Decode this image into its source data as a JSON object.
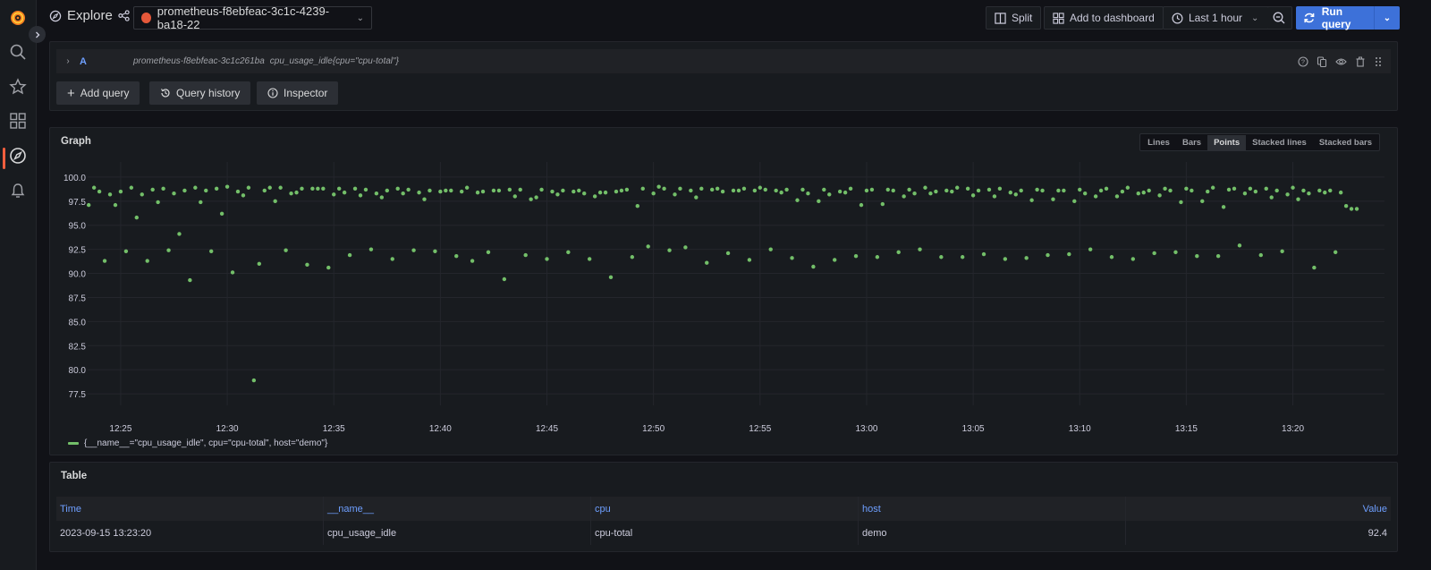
{
  "sidebar": {
    "items": [
      {
        "name": "grafana-logo",
        "label": "Home"
      },
      {
        "name": "search",
        "label": "Search"
      },
      {
        "name": "starred",
        "label": "Starred"
      },
      {
        "name": "dashboards",
        "label": "Dashboards"
      },
      {
        "name": "explore",
        "label": "Explore",
        "active": true
      },
      {
        "name": "alerting",
        "label": "Alerting"
      }
    ]
  },
  "header": {
    "title": "Explore",
    "datasource": "prometheus-f8ebfeac-3c1c-4239-ba18-22",
    "split_label": "Split",
    "add_to_dashboard_label": "Add to dashboard",
    "time_range_label": "Last 1 hour",
    "run_query_label": "Run query"
  },
  "query": {
    "ref_id": "A",
    "datasource": "prometheus-f8ebfeac-3c1c261ba",
    "expression": "cpu_usage_idle{cpu=\"cpu-total\"}",
    "add_query_label": "Add query",
    "query_history_label": "Query history",
    "inspector_label": "Inspector"
  },
  "graph_panel": {
    "title": "Graph",
    "view_options": [
      "Lines",
      "Bars",
      "Points",
      "Stacked lines",
      "Stacked bars"
    ],
    "selected_view": "Points"
  },
  "chart_data": {
    "type": "scatter",
    "title": "Graph",
    "xlabel": "",
    "ylabel": "",
    "x_ticks": [
      "12:25",
      "12:30",
      "12:35",
      "12:40",
      "12:45",
      "12:50",
      "12:55",
      "13:00",
      "13:05",
      "13:10",
      "13:15",
      "13:20"
    ],
    "y_ticks": [
      "77.5",
      "80.0",
      "82.5",
      "85.0",
      "87.5",
      "90.0",
      "92.5",
      "95.0",
      "97.5",
      "100.0"
    ],
    "ylim": [
      76.3,
      101.2
    ],
    "xlim_minutes_from_1225": [
      -1.55,
      59.3
    ],
    "x_interval_seconds": 15,
    "x_start": "12:23:30",
    "grid": true,
    "color": "#73bf69",
    "series": [
      {
        "name": "{__name__=\"cpu_usage_idle\", cpu=\"cpu-total\", host=\"demo\"}",
        "values": [
          97.1,
          98.9,
          98.5,
          91.3,
          98.2,
          97.1,
          98.5,
          92.3,
          98.9,
          95.8,
          98.2,
          91.3,
          98.7,
          97.4,
          98.8,
          92.4,
          98.3,
          94.1,
          98.6,
          89.3,
          98.9,
          97.4,
          98.6,
          92.3,
          98.8,
          96.2,
          99.0,
          90.1,
          98.5,
          98.1,
          98.9,
          78.9,
          91.0,
          98.6,
          98.9,
          97.5,
          98.9,
          92.4,
          98.3,
          98.4,
          98.8,
          90.9,
          98.8,
          98.8,
          98.8,
          90.6,
          98.2,
          98.8,
          98.4,
          91.9,
          98.8,
          98.1,
          98.7,
          92.5,
          98.3,
          97.9,
          98.6,
          91.5,
          98.8,
          98.3,
          98.7,
          92.4,
          98.4,
          97.7,
          98.6,
          92.3,
          98.5,
          98.6,
          98.6,
          91.8,
          98.5,
          98.9,
          91.3,
          98.4,
          98.5,
          92.2,
          98.6,
          98.6,
          89.4,
          98.7,
          98.0,
          98.7,
          91.9,
          97.7,
          97.9,
          98.7,
          91.5,
          98.5,
          98.2,
          98.6,
          92.2,
          98.5,
          98.6,
          98.3,
          91.5,
          98.0,
          98.4,
          98.4,
          89.6,
          98.5,
          98.6,
          98.7,
          91.7,
          97.0,
          98.8,
          92.8,
          98.3,
          99.0,
          98.8,
          92.4,
          98.2,
          98.8,
          92.7,
          98.6,
          97.9,
          98.8,
          91.1,
          98.7,
          98.8,
          98.5,
          92.1,
          98.6,
          98.6,
          98.8,
          91.4,
          98.6,
          98.9,
          98.7,
          92.5,
          98.6,
          98.4,
          98.7,
          91.6,
          97.6,
          98.7,
          98.3,
          90.7,
          97.5,
          98.7,
          98.2,
          91.4,
          98.5,
          98.4,
          98.8,
          91.8,
          97.1,
          98.6,
          98.7,
          91.7,
          97.2,
          98.7,
          98.6,
          92.2,
          98.0,
          98.7,
          98.3,
          92.5,
          98.9,
          98.3,
          98.5,
          91.7,
          98.6,
          98.5,
          98.9,
          91.7,
          98.8,
          98.1,
          98.6,
          92.0,
          98.7,
          98.0,
          98.8,
          91.5,
          98.4,
          98.2,
          98.6,
          91.6,
          97.6,
          98.7,
          98.6,
          91.9,
          97.7,
          98.6,
          98.6,
          92.0,
          97.5,
          98.7,
          98.3,
          92.5,
          98.0,
          98.6,
          98.8,
          91.7,
          98.0,
          98.5,
          98.9,
          91.5,
          98.3,
          98.4,
          98.6,
          92.1,
          98.1,
          98.8,
          98.6,
          92.2,
          97.4,
          98.8,
          98.6,
          91.8,
          97.5,
          98.5,
          98.9,
          91.8,
          96.9,
          98.7,
          98.8,
          92.9,
          98.3,
          98.8,
          98.5,
          91.9,
          98.8,
          97.9,
          98.6,
          92.3,
          98.2,
          98.9,
          97.7,
          98.6,
          98.3,
          90.6,
          98.6,
          98.4,
          98.6,
          92.2,
          98.4,
          97.0,
          96.7,
          96.7
        ]
      }
    ]
  },
  "table_panel": {
    "title": "Table",
    "columns": [
      "Time",
      "__name__",
      "cpu",
      "host",
      "Value"
    ],
    "rows": [
      [
        "2023-09-15 13:23:20",
        "cpu_usage_idle",
        "cpu-total",
        "demo",
        "92.4"
      ]
    ]
  }
}
